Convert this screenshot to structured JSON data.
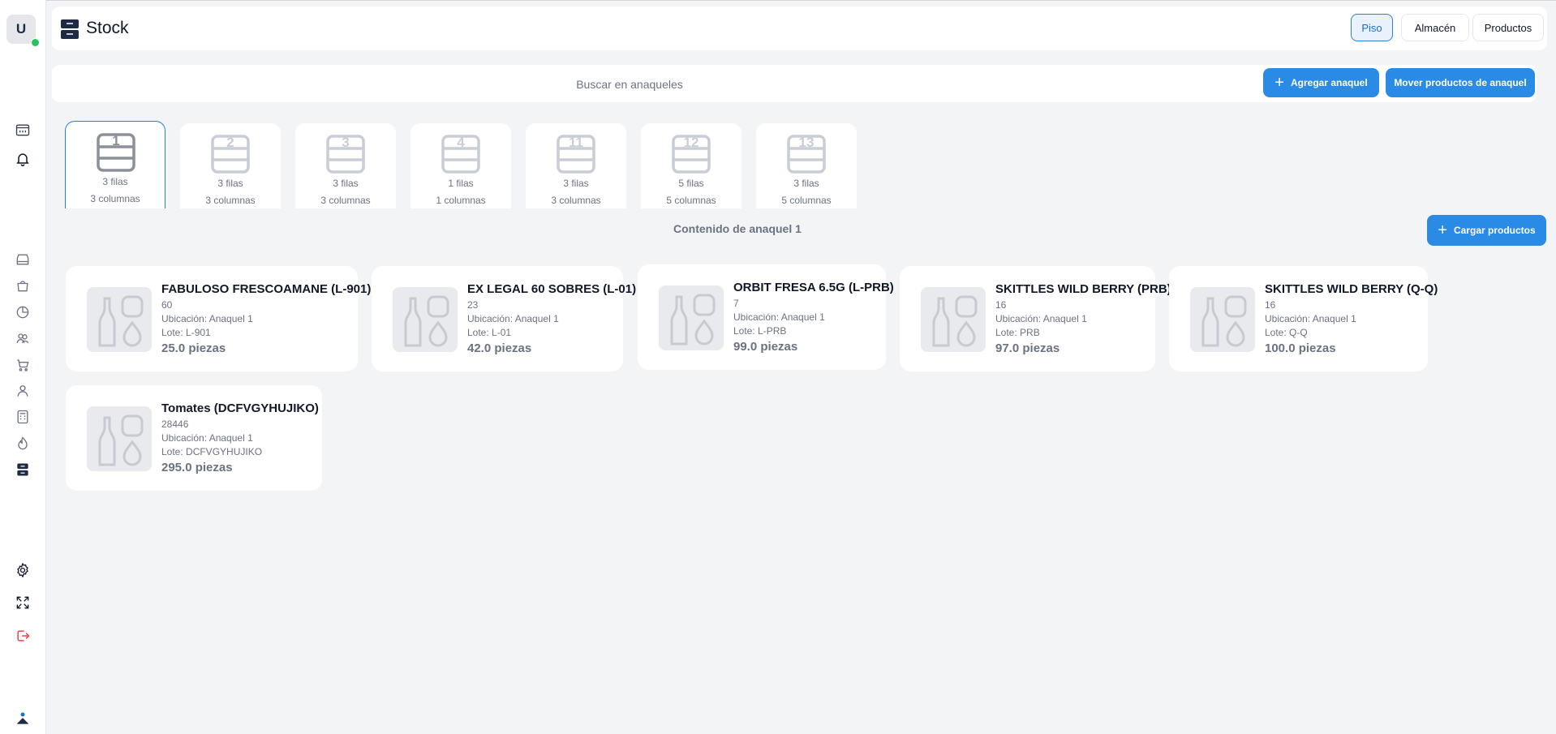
{
  "sidebar": {
    "avatar_initial": "U",
    "icons": [
      "calendar-icon",
      "bell-icon",
      "store-icon",
      "bag-icon",
      "chart-pie-icon",
      "users-icon",
      "cart-icon",
      "user-icon",
      "calculator-icon",
      "fire-icon",
      "stock-icon",
      "gear-icon",
      "expand-icon",
      "logout-icon",
      "brand-icon"
    ]
  },
  "header": {
    "title": "Stock",
    "tabs": [
      {
        "label": "Piso",
        "active": true
      },
      {
        "label": "Almacén",
        "active": false
      },
      {
        "label": "Productos",
        "active": false
      }
    ]
  },
  "search": {
    "placeholder": "Buscar en anaqueles",
    "add_shelf_label": "Agregar anaquel",
    "move_products_label": "Mover productos de anaquel"
  },
  "shelves": [
    {
      "num": "1",
      "rows": "3 filas",
      "cols": "3 columnas",
      "active": true
    },
    {
      "num": "2",
      "rows": "3 filas",
      "cols": "3 columnas",
      "active": false
    },
    {
      "num": "3",
      "rows": "3 filas",
      "cols": "3 columnas",
      "active": false
    },
    {
      "num": "4",
      "rows": "1 filas",
      "cols": "1 columnas",
      "active": false
    },
    {
      "num": "11",
      "rows": "3 filas",
      "cols": "3 columnas",
      "active": false
    },
    {
      "num": "12",
      "rows": "5 filas",
      "cols": "5 columnas",
      "active": false
    },
    {
      "num": "13",
      "rows": "3 filas",
      "cols": "5 columnas",
      "active": false
    }
  ],
  "content": {
    "title": "Contenido de anaquel 1",
    "load_products_label": "Cargar productos"
  },
  "products": [
    {
      "name": "FABULOSO FRESCOAMANE (L-901)",
      "code": "60",
      "location": "Ubicación: Anaquel 1",
      "lot": "Lote: L-901",
      "qty": "25.0 piezas"
    },
    {
      "name": "EX LEGAL 60 SOBRES (L-01)",
      "code": "23",
      "location": "Ubicación: Anaquel 1",
      "lot": "Lote: L-01",
      "qty": "42.0 piezas"
    },
    {
      "name": "ORBIT FRESA 6.5G (L-PRB)",
      "code": "7",
      "location": "Ubicación: Anaquel 1",
      "lot": "Lote: L-PRB",
      "qty": "99.0 piezas"
    },
    {
      "name": "SKITTLES WILD BERRY (PRB)",
      "code": "16",
      "location": "Ubicación: Anaquel 1",
      "lot": "Lote: PRB",
      "qty": "97.0 piezas"
    },
    {
      "name": "SKITTLES WILD BERRY (Q-Q)",
      "code": "16",
      "location": "Ubicación: Anaquel 1",
      "lot": "Lote: Q-Q",
      "qty": "100.0 piezas"
    },
    {
      "name": "Tomates (DCFVGYHUJIKO)",
      "code": "28446",
      "location": "Ubicación: Anaquel 1",
      "lot": "Lote: DCFVGYHUJIKO",
      "qty": "295.0 piezas"
    }
  ]
}
